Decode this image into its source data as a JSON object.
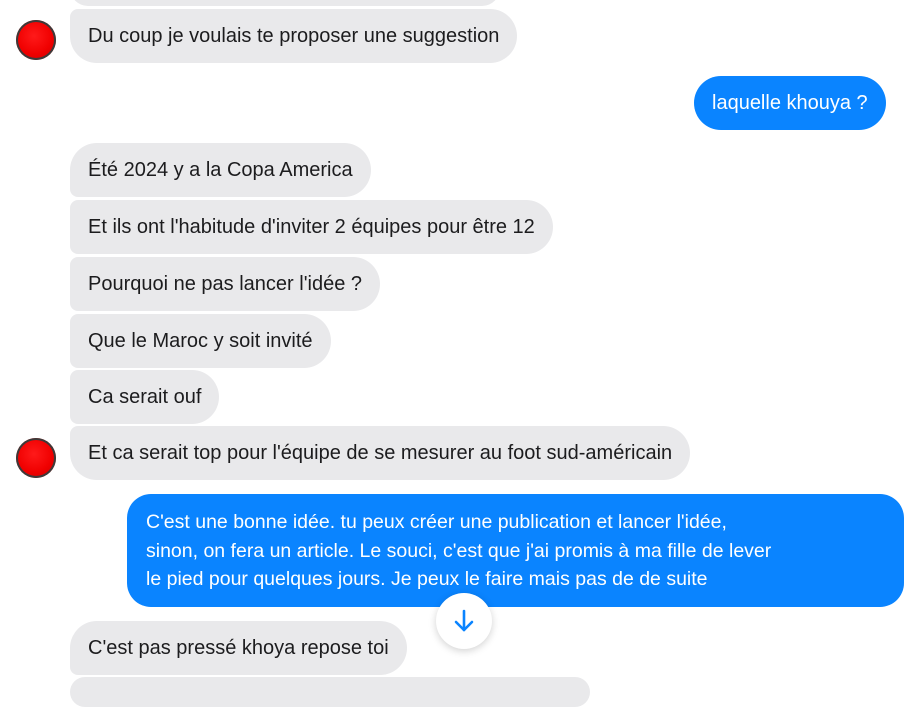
{
  "conversation": {
    "messages": [
      {
        "sender": "other",
        "text": "Du coup je voulais te proposer une suggestion"
      },
      {
        "sender": "me",
        "text": "laquelle khouya ?"
      },
      {
        "sender": "other",
        "text": "Été 2024 y a la Copa America"
      },
      {
        "sender": "other",
        "text": "Et ils ont l'habitude d'inviter 2 équipes pour être 12"
      },
      {
        "sender": "other",
        "text": "Pourquoi ne pas lancer l'idée ?"
      },
      {
        "sender": "other",
        "text": "Que le Maroc y soit invité"
      },
      {
        "sender": "other",
        "text": "Ca serait ouf"
      },
      {
        "sender": "other",
        "text": "Et ca serait top pour l'équipe de se mesurer au foot sud-américain"
      },
      {
        "sender": "me",
        "lines": [
          "C'est une bonne idée. tu peux créer une publication et lancer l'idée,",
          "sinon, on fera un article. Le souci, c'est que j'ai promis à ma fille de lever",
          "le pied pour quelques jours. Je peux le faire mais pas de de suite"
        ]
      },
      {
        "sender": "other",
        "text": "C'est pas pressé khoya repose toi"
      }
    ]
  },
  "colors": {
    "incoming_bubble": "#e9e9eb",
    "outgoing_bubble": "#0a84ff",
    "avatar": "#f00000",
    "scroll_arrow": "#0a84ff"
  },
  "icons": {
    "scroll_down": "arrow-down-icon"
  }
}
